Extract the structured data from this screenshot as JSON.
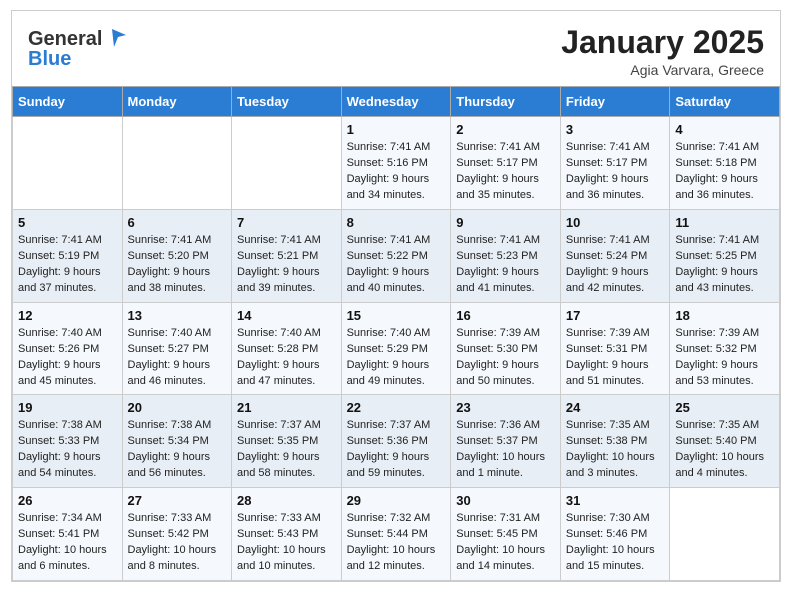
{
  "header": {
    "logo_line1": "General",
    "logo_line2": "Blue",
    "title": "January 2025",
    "subtitle": "Agia Varvara, Greece"
  },
  "weekdays": [
    "Sunday",
    "Monday",
    "Tuesday",
    "Wednesday",
    "Thursday",
    "Friday",
    "Saturday"
  ],
  "weeks": [
    [
      {
        "day": "",
        "info": ""
      },
      {
        "day": "",
        "info": ""
      },
      {
        "day": "",
        "info": ""
      },
      {
        "day": "1",
        "info": "Sunrise: 7:41 AM\nSunset: 5:16 PM\nDaylight: 9 hours\nand 34 minutes."
      },
      {
        "day": "2",
        "info": "Sunrise: 7:41 AM\nSunset: 5:17 PM\nDaylight: 9 hours\nand 35 minutes."
      },
      {
        "day": "3",
        "info": "Sunrise: 7:41 AM\nSunset: 5:17 PM\nDaylight: 9 hours\nand 36 minutes."
      },
      {
        "day": "4",
        "info": "Sunrise: 7:41 AM\nSunset: 5:18 PM\nDaylight: 9 hours\nand 36 minutes."
      }
    ],
    [
      {
        "day": "5",
        "info": "Sunrise: 7:41 AM\nSunset: 5:19 PM\nDaylight: 9 hours\nand 37 minutes."
      },
      {
        "day": "6",
        "info": "Sunrise: 7:41 AM\nSunset: 5:20 PM\nDaylight: 9 hours\nand 38 minutes."
      },
      {
        "day": "7",
        "info": "Sunrise: 7:41 AM\nSunset: 5:21 PM\nDaylight: 9 hours\nand 39 minutes."
      },
      {
        "day": "8",
        "info": "Sunrise: 7:41 AM\nSunset: 5:22 PM\nDaylight: 9 hours\nand 40 minutes."
      },
      {
        "day": "9",
        "info": "Sunrise: 7:41 AM\nSunset: 5:23 PM\nDaylight: 9 hours\nand 41 minutes."
      },
      {
        "day": "10",
        "info": "Sunrise: 7:41 AM\nSunset: 5:24 PM\nDaylight: 9 hours\nand 42 minutes."
      },
      {
        "day": "11",
        "info": "Sunrise: 7:41 AM\nSunset: 5:25 PM\nDaylight: 9 hours\nand 43 minutes."
      }
    ],
    [
      {
        "day": "12",
        "info": "Sunrise: 7:40 AM\nSunset: 5:26 PM\nDaylight: 9 hours\nand 45 minutes."
      },
      {
        "day": "13",
        "info": "Sunrise: 7:40 AM\nSunset: 5:27 PM\nDaylight: 9 hours\nand 46 minutes."
      },
      {
        "day": "14",
        "info": "Sunrise: 7:40 AM\nSunset: 5:28 PM\nDaylight: 9 hours\nand 47 minutes."
      },
      {
        "day": "15",
        "info": "Sunrise: 7:40 AM\nSunset: 5:29 PM\nDaylight: 9 hours\nand 49 minutes."
      },
      {
        "day": "16",
        "info": "Sunrise: 7:39 AM\nSunset: 5:30 PM\nDaylight: 9 hours\nand 50 minutes."
      },
      {
        "day": "17",
        "info": "Sunrise: 7:39 AM\nSunset: 5:31 PM\nDaylight: 9 hours\nand 51 minutes."
      },
      {
        "day": "18",
        "info": "Sunrise: 7:39 AM\nSunset: 5:32 PM\nDaylight: 9 hours\nand 53 minutes."
      }
    ],
    [
      {
        "day": "19",
        "info": "Sunrise: 7:38 AM\nSunset: 5:33 PM\nDaylight: 9 hours\nand 54 minutes."
      },
      {
        "day": "20",
        "info": "Sunrise: 7:38 AM\nSunset: 5:34 PM\nDaylight: 9 hours\nand 56 minutes."
      },
      {
        "day": "21",
        "info": "Sunrise: 7:37 AM\nSunset: 5:35 PM\nDaylight: 9 hours\nand 58 minutes."
      },
      {
        "day": "22",
        "info": "Sunrise: 7:37 AM\nSunset: 5:36 PM\nDaylight: 9 hours\nand 59 minutes."
      },
      {
        "day": "23",
        "info": "Sunrise: 7:36 AM\nSunset: 5:37 PM\nDaylight: 10 hours\nand 1 minute."
      },
      {
        "day": "24",
        "info": "Sunrise: 7:35 AM\nSunset: 5:38 PM\nDaylight: 10 hours\nand 3 minutes."
      },
      {
        "day": "25",
        "info": "Sunrise: 7:35 AM\nSunset: 5:40 PM\nDaylight: 10 hours\nand 4 minutes."
      }
    ],
    [
      {
        "day": "26",
        "info": "Sunrise: 7:34 AM\nSunset: 5:41 PM\nDaylight: 10 hours\nand 6 minutes."
      },
      {
        "day": "27",
        "info": "Sunrise: 7:33 AM\nSunset: 5:42 PM\nDaylight: 10 hours\nand 8 minutes."
      },
      {
        "day": "28",
        "info": "Sunrise: 7:33 AM\nSunset: 5:43 PM\nDaylight: 10 hours\nand 10 minutes."
      },
      {
        "day": "29",
        "info": "Sunrise: 7:32 AM\nSunset: 5:44 PM\nDaylight: 10 hours\nand 12 minutes."
      },
      {
        "day": "30",
        "info": "Sunrise: 7:31 AM\nSunset: 5:45 PM\nDaylight: 10 hours\nand 14 minutes."
      },
      {
        "day": "31",
        "info": "Sunrise: 7:30 AM\nSunset: 5:46 PM\nDaylight: 10 hours\nand 15 minutes."
      },
      {
        "day": "",
        "info": ""
      }
    ]
  ]
}
